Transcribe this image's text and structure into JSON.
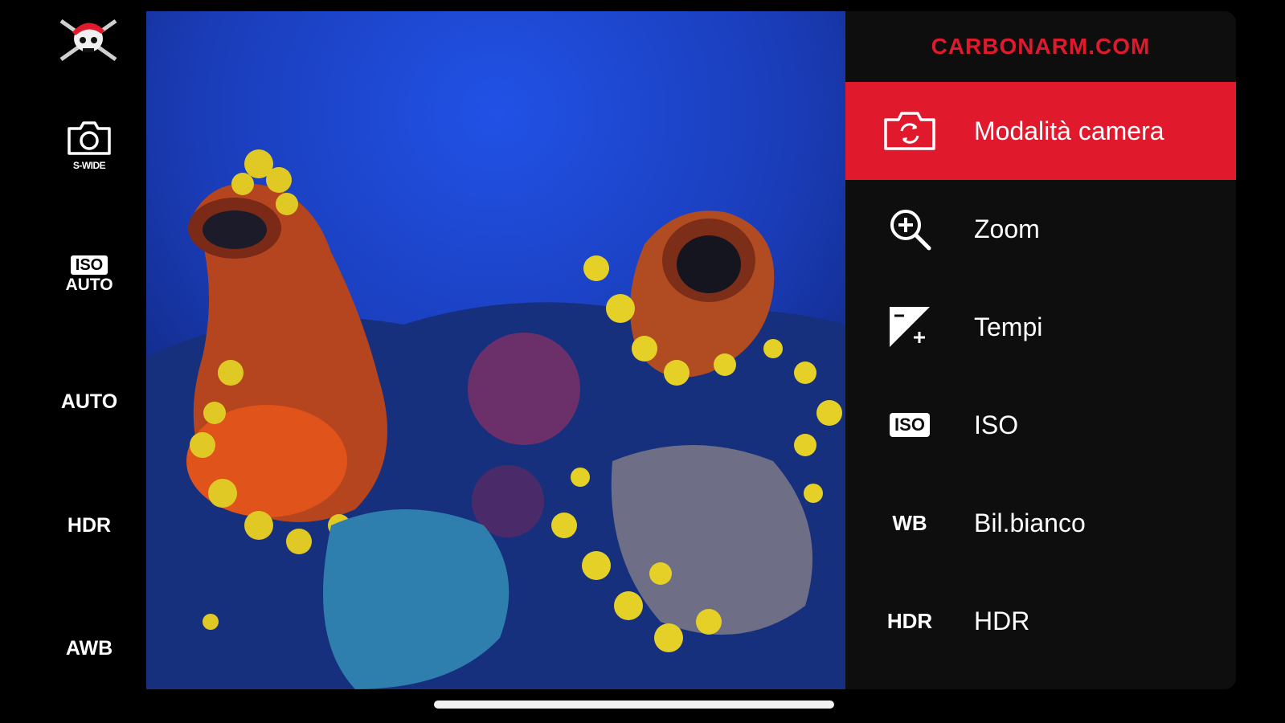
{
  "left_bar": {
    "camera_mode_sub": "S-WIDE",
    "iso_label": "ISO",
    "iso_value": "AUTO",
    "auto_label": "AUTO",
    "hdr_label": "HDR",
    "awb_label": "AWB"
  },
  "menu": {
    "brand": "CARBONARM.COM",
    "items": [
      {
        "label": "Modalità camera",
        "icon": "camera-switch-icon",
        "active": true
      },
      {
        "label": "Zoom",
        "icon": "zoom-in-icon"
      },
      {
        "label": "Tempi",
        "icon": "exposure-icon"
      },
      {
        "label": "ISO",
        "icon_text": "ISO"
      },
      {
        "label": "Bil.bianco",
        "icon_text": "WB"
      },
      {
        "label": "HDR",
        "icon_text": "HDR"
      }
    ]
  },
  "colors": {
    "accent": "#e0192d",
    "panel": "#0e0e0e",
    "background": "#000000"
  }
}
